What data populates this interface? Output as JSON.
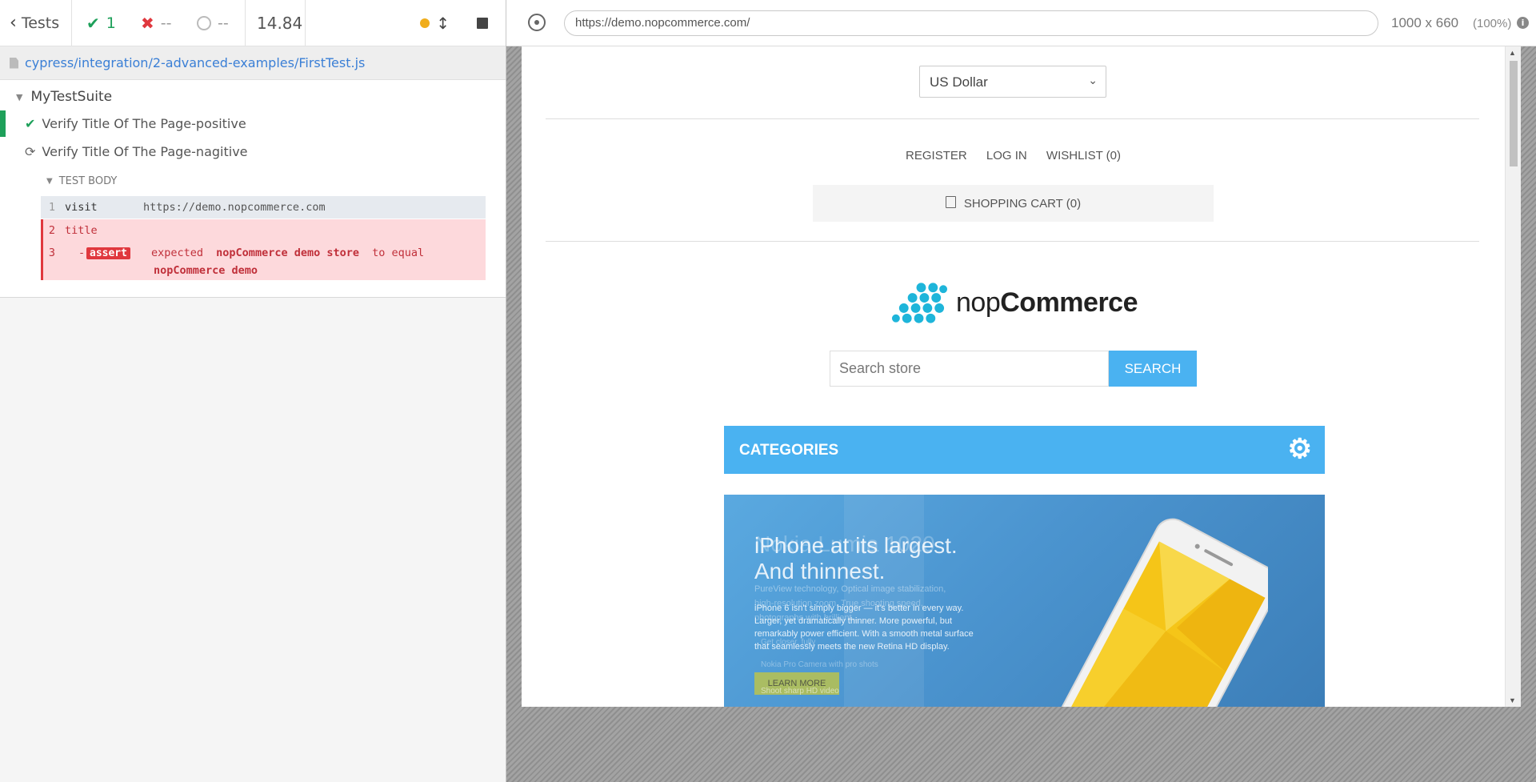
{
  "reporter": {
    "back_label": "Tests",
    "passed": "1",
    "failed": "--",
    "pending": "--",
    "duration": "14.84",
    "spec_path": "cypress/integration/2-advanced-examples/FirstTest.js",
    "suite_name": "MyTestSuite",
    "tests": [
      {
        "title": "Verify Title Of The Page-positive",
        "state": "passed"
      },
      {
        "title": "Verify Title Of The Page-nagitive",
        "state": "running"
      }
    ],
    "test_body_label": "TEST BODY",
    "commands": [
      {
        "num": "1",
        "name": "visit",
        "message": "https://demo.nopcommerce.com"
      },
      {
        "num": "2",
        "name": "title"
      },
      {
        "num": "3",
        "prefix": "-",
        "name": "assert",
        "msg_word1": "expected",
        "msg_bold1": "nopCommerce demo store",
        "msg_word2": "to equal",
        "msg_bold2": "nopCommerce demo"
      }
    ]
  },
  "aut": {
    "url": "https://demo.nopcommerce.com/",
    "viewport": "1000 x 660",
    "zoom": "(100%)"
  },
  "app": {
    "currency": "US Dollar",
    "links": [
      "REGISTER",
      "LOG IN",
      "WISHLIST (0)"
    ],
    "cart": "SHOPPING CART (0)",
    "logo_text_light": "nop",
    "logo_text_bold": "Commerce",
    "search_placeholder": "Search store",
    "search_button": "SEARCH",
    "categories": "CATEGORIES",
    "slider": {
      "headline1": "iPhone at its largest.",
      "headline2": "And thinnest.",
      "body1": "iPhone 6 isn't simply bigger — it's better in every way.",
      "body2": "Larger, yet dramatically thinner. More powerful, but",
      "body3": "remarkably power efficient. With a smooth metal surface",
      "body4": "that seamlessly meets the new Retina HD display.",
      "button": "LEARN MORE",
      "ghost_title": "Nokia Lumia 1020",
      "ghost_line1": "PureView technology, Optical image stabilization,",
      "ghost_line2": "high-resolution zoom. True shooting speed,",
      "ghost_line3": "photographs with brilliant...",
      "ghost_line4": "Get closer, fully",
      "ghost_line5": "Nokia Pro Camera with pro shots",
      "ghost_line6": "Shoot sharp HD video"
    }
  },
  "colors": {
    "pass": "#1ea05a",
    "fail": "#e0383e",
    "accent": "#4ab2f1",
    "link": "#3a7fd6"
  }
}
